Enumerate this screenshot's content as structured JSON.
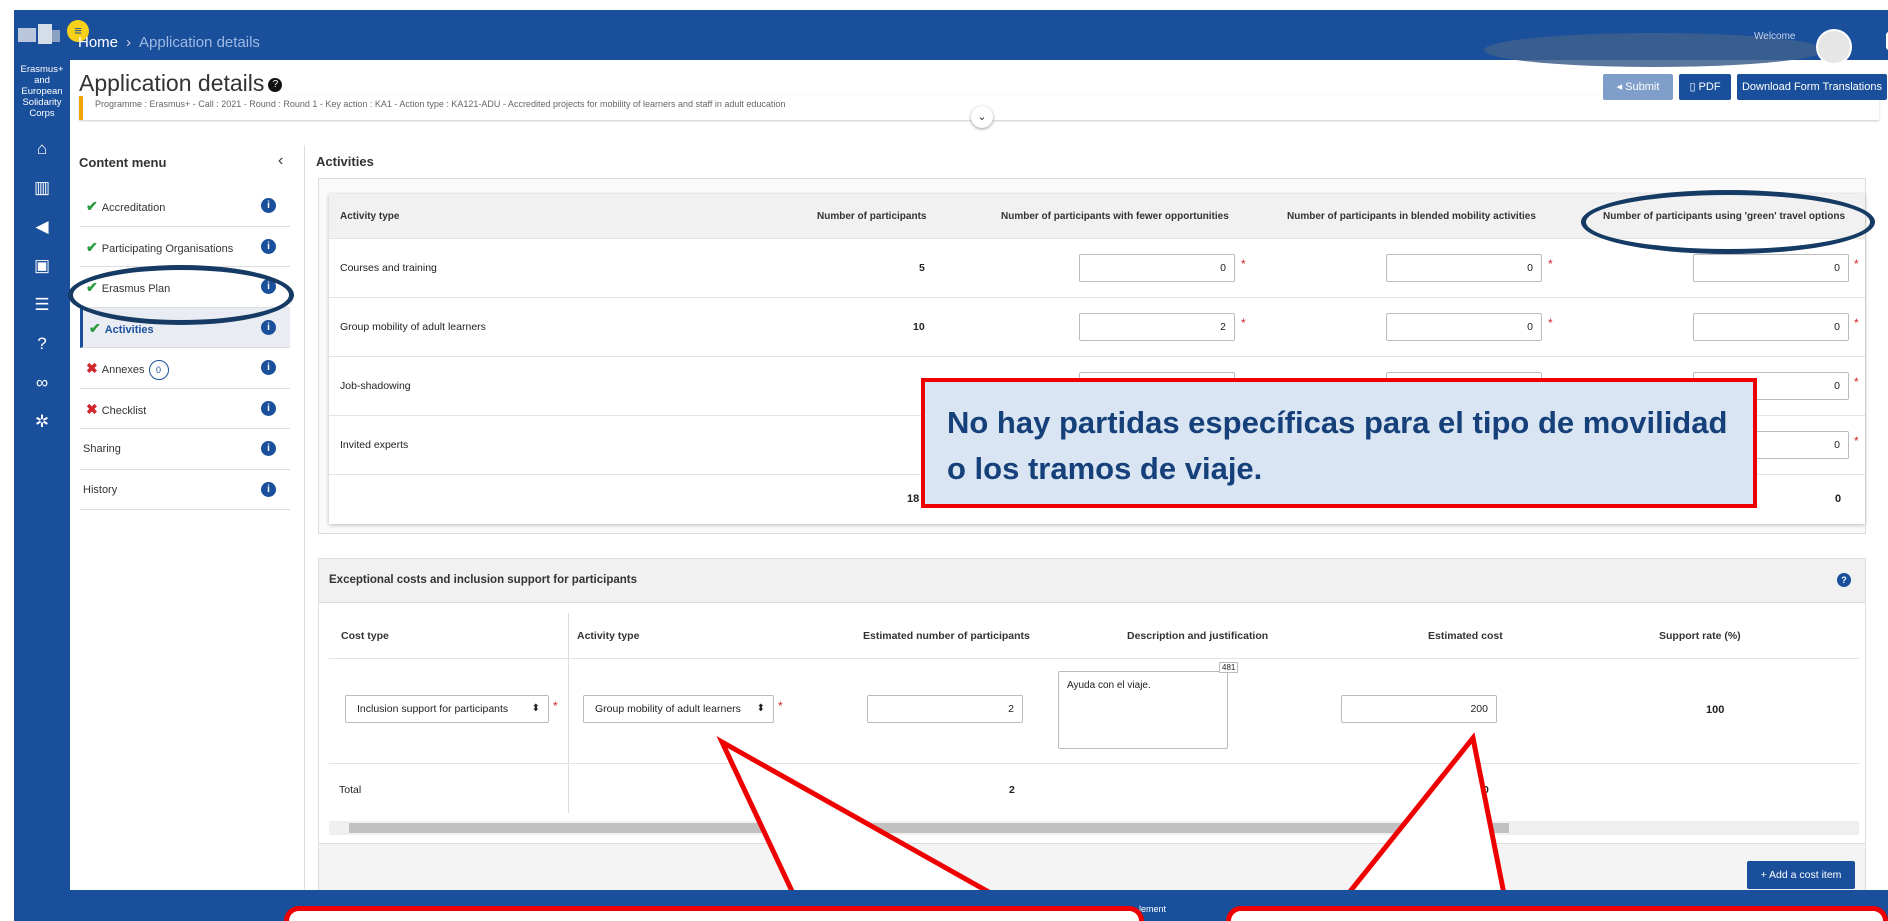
{
  "topbar": {
    "home": "Home",
    "separator": "›",
    "current": "Application details",
    "welcome": "Welcome",
    "menu_glyph": "≡"
  },
  "rail": {
    "brand": [
      "Erasmus+",
      "and",
      "European",
      "Solidarity",
      "Corps"
    ],
    "icons": [
      "home-icon",
      "bank-icon",
      "megaphone-icon",
      "code-file-icon",
      "server-icon",
      "help-icon",
      "link-icon",
      "gears-icon"
    ]
  },
  "header": {
    "title": "Application details",
    "programme": "Programme : Erasmus+ - Call : 2021 - Round : Round 1 - Key action : KA1 - Action type : KA121-ADU - Accredited projects for mobility of learners and staff in adult education",
    "buttons": {
      "submit": "Submit",
      "pdf": "PDF",
      "translations": "Download Form Translations"
    }
  },
  "content_menu": {
    "title": "Content menu",
    "items": [
      {
        "label": "Accreditation",
        "status": "ok"
      },
      {
        "label": "Participating Organisations",
        "status": "ok"
      },
      {
        "label": "Erasmus Plan",
        "status": "ok"
      },
      {
        "label": "Activities",
        "status": "ok",
        "active": true
      },
      {
        "label": "Annexes",
        "status": "error",
        "badge": "0"
      },
      {
        "label": "Checklist",
        "status": "error"
      },
      {
        "label": "Sharing",
        "status": "none"
      },
      {
        "label": "History",
        "status": "none"
      }
    ]
  },
  "activities": {
    "title": "Activities",
    "columns": [
      "Activity type",
      "Number of participants",
      "Number of participants with fewer opportunities",
      "Number of participants in blended mobility activities",
      "Number of participants using 'green' travel options"
    ],
    "rows": [
      {
        "type": "Courses and training",
        "participants": "5",
        "fewer": "0",
        "blended": "0",
        "green": "0"
      },
      {
        "type": "Group mobility of adult learners",
        "participants": "10",
        "fewer": "2",
        "blended": "0",
        "green": "0"
      },
      {
        "type": "Job-shadowing",
        "participants": "",
        "fewer": "",
        "blended": "",
        "green": "0"
      },
      {
        "type": "Invited experts",
        "participants": "",
        "fewer": "",
        "blended": "",
        "green": "0"
      }
    ],
    "total_participants": "18",
    "total_green": "0"
  },
  "callout": {
    "text": "No hay partidas específicas para el tipo de movilidad o los tramos de viaje."
  },
  "exceptional": {
    "title": "Exceptional costs and inclusion support for participants",
    "columns": [
      "Cost type",
      "Activity type",
      "Estimated number of participants",
      "Description and justification",
      "Estimated cost",
      "Support rate (%)"
    ],
    "row": {
      "cost_type": "Inclusion support for participants",
      "activity_type": "Group mobility of adult learners",
      "participants": "2",
      "description": "Ayuda con el viaje.",
      "counter": "481",
      "cost": "200",
      "rate": "100"
    },
    "total_label": "Total",
    "total_participants": "2",
    "total_cost_fragment": "0",
    "add_button": "+ Add a cost item"
  },
  "footer": {
    "text": "lement"
  }
}
